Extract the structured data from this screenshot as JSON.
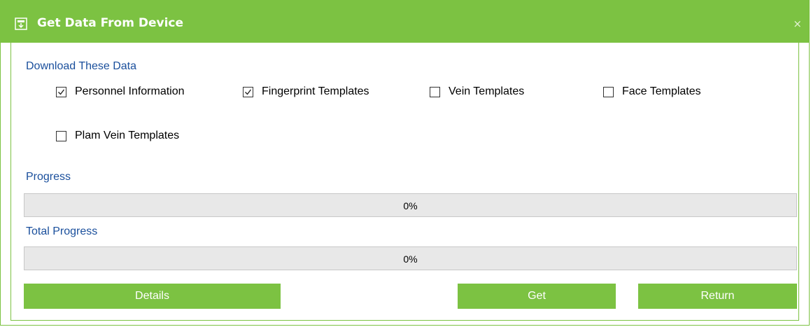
{
  "window": {
    "title": "Get Data From Device",
    "close_label": "×",
    "accent": "#7cc242"
  },
  "download": {
    "label": "Download These Data",
    "options": [
      {
        "label": "Personnel Information",
        "checked": true
      },
      {
        "label": "Fingerprint Templates",
        "checked": true
      },
      {
        "label": "Vein Templates",
        "checked": false
      },
      {
        "label": "Face Templates",
        "checked": false
      },
      {
        "label": "Plam Vein Templates",
        "checked": false
      }
    ]
  },
  "progress": {
    "label": "Progress",
    "value_text": "0%",
    "value": 0
  },
  "total_progress": {
    "label": "Total Progress",
    "value_text": "0%",
    "value": 0
  },
  "buttons": {
    "details": "Details",
    "get": "Get",
    "return": "Return"
  }
}
